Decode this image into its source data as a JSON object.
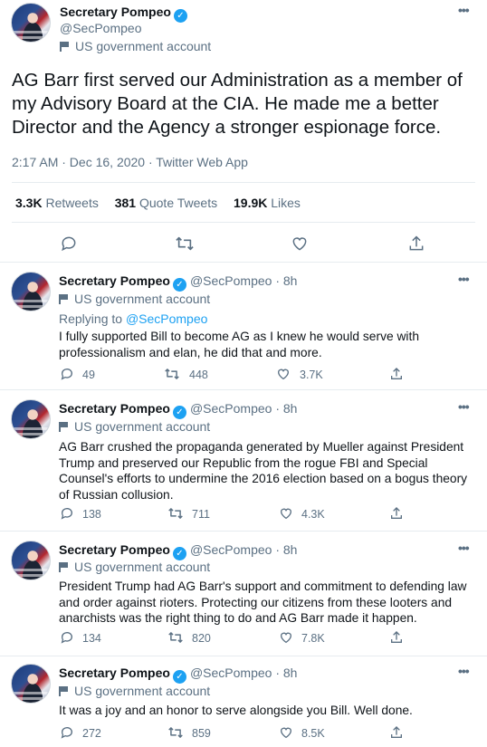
{
  "main_tweet": {
    "name": "Secretary Pompeo",
    "handle": "@SecPompeo",
    "label": "US government account",
    "text": "AG Barr first served our Administration as a member of my Advisory Board at the CIA. He made me a better Director and the Agency a stronger espionage force.",
    "timestamp": "2:17 AM · Dec 16, 2020 · Twitter Web App",
    "stats": {
      "retweets_count": "3.3K",
      "retweets_label": "Retweets",
      "quote_count": "381",
      "quote_label": "Quote Tweets",
      "likes_count": "19.9K",
      "likes_label": "Likes"
    }
  },
  "replies": [
    {
      "name": "Secretary Pompeo",
      "handle_time": "@SecPompeo · 8h",
      "label": "US government account",
      "replying_prefix": "Replying to",
      "replying_to": "@SecPompeo",
      "text": "I fully supported Bill to become AG as I knew he would serve with professionalism and elan, he did that and more.",
      "replies": "49",
      "retweets": "448",
      "likes": "3.7K"
    },
    {
      "name": "Secretary Pompeo",
      "handle_time": "@SecPompeo · 8h",
      "label": "US government account",
      "text": "AG Barr crushed the propaganda generated by Mueller against President Trump and preserved our Republic from the rogue FBI and Special Counsel's efforts to undermine the 2016 election based on a bogus theory of Russian collusion.",
      "replies": "138",
      "retweets": "711",
      "likes": "4.3K"
    },
    {
      "name": "Secretary Pompeo",
      "handle_time": "@SecPompeo · 8h",
      "label": "US government account",
      "text": "President Trump had AG Barr's support and commitment to defending law and order against rioters. Protecting our citizens from these looters and anarchists was the right thing to do and AG Barr made it happen.",
      "replies": "134",
      "retweets": "820",
      "likes": "7.8K"
    },
    {
      "name": "Secretary Pompeo",
      "handle_time": "@SecPompeo · 8h",
      "label": "US government account",
      "text": "It was a joy and an honor to serve alongside you Bill. Well done.",
      "replies": "272",
      "retweets": "859",
      "likes": "8.5K"
    }
  ],
  "icons": {
    "more": "more-icon",
    "verified": "verified-badge-icon",
    "govt": "flag-icon",
    "reply": "reply-icon",
    "retweet": "retweet-icon",
    "like": "like-icon",
    "share": "share-icon"
  },
  "colors": {
    "accent": "#1da1f2",
    "secondary_text": "#5b7083",
    "border": "#e6ecf0"
  }
}
